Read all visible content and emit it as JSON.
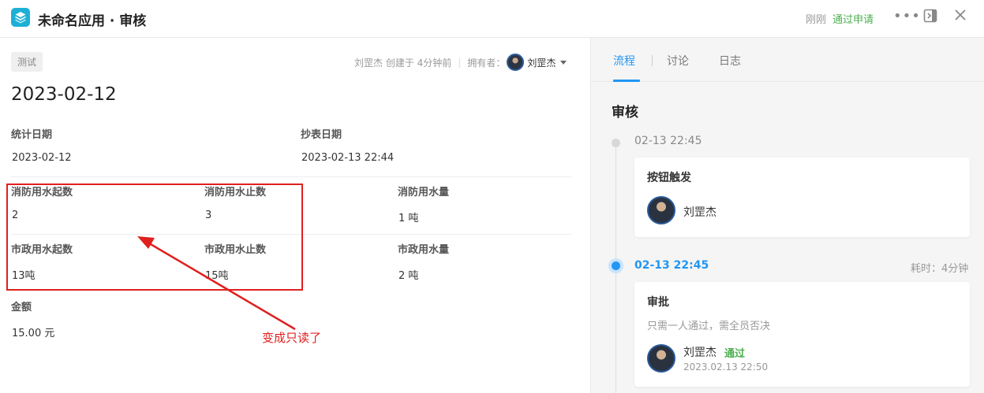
{
  "header": {
    "title": "未命名应用 · 审核",
    "time": "刚刚",
    "status": "通过申请"
  },
  "record": {
    "tag": "测试",
    "creator_meta": "刘罡杰 创建于 4分钟前",
    "owner_label": "拥有者：",
    "owner_name": "刘罡杰",
    "title": "2023-02-12"
  },
  "fields": {
    "stat_date": {
      "label": "统计日期",
      "value": "2023-02-12"
    },
    "copy_date": {
      "label": "抄表日期",
      "value": "2023-02-13 22:44"
    },
    "fire_start": {
      "label": "消防用水起数",
      "value": "2"
    },
    "fire_end": {
      "label": "消防用水止数",
      "value": "3"
    },
    "fire_amount": {
      "label": "消防用水量",
      "value": "1 吨"
    },
    "muni_start": {
      "label": "市政用水起数",
      "value": "13吨"
    },
    "muni_end": {
      "label": "市政用水止数",
      "value": "15吨"
    },
    "muni_amount": {
      "label": "市政用水量",
      "value": "2 吨"
    },
    "amount": {
      "label": "金额",
      "value": "15.00 元"
    }
  },
  "annotation": "变成只读了",
  "panel": {
    "tabs": [
      {
        "label": "流程"
      },
      {
        "label": "讨论"
      },
      {
        "label": "日志"
      }
    ],
    "title": "审核",
    "timeline": [
      {
        "time": "02-13 22:45",
        "card_title": "按钮触发",
        "person": "刘罡杰"
      },
      {
        "time": "02-13 22:45",
        "duration": "耗时：4分钟",
        "card_title": "审批",
        "desc": "只需一人通过，需全员否决",
        "person": "刘罡杰",
        "result": "通过",
        "timestamp": "2023.02.13 22:50"
      }
    ]
  },
  "colors": {
    "accent": "#2196f3",
    "success": "#4caf50",
    "annotation": "#e0201f",
    "app_icon": "#1db0d6"
  }
}
